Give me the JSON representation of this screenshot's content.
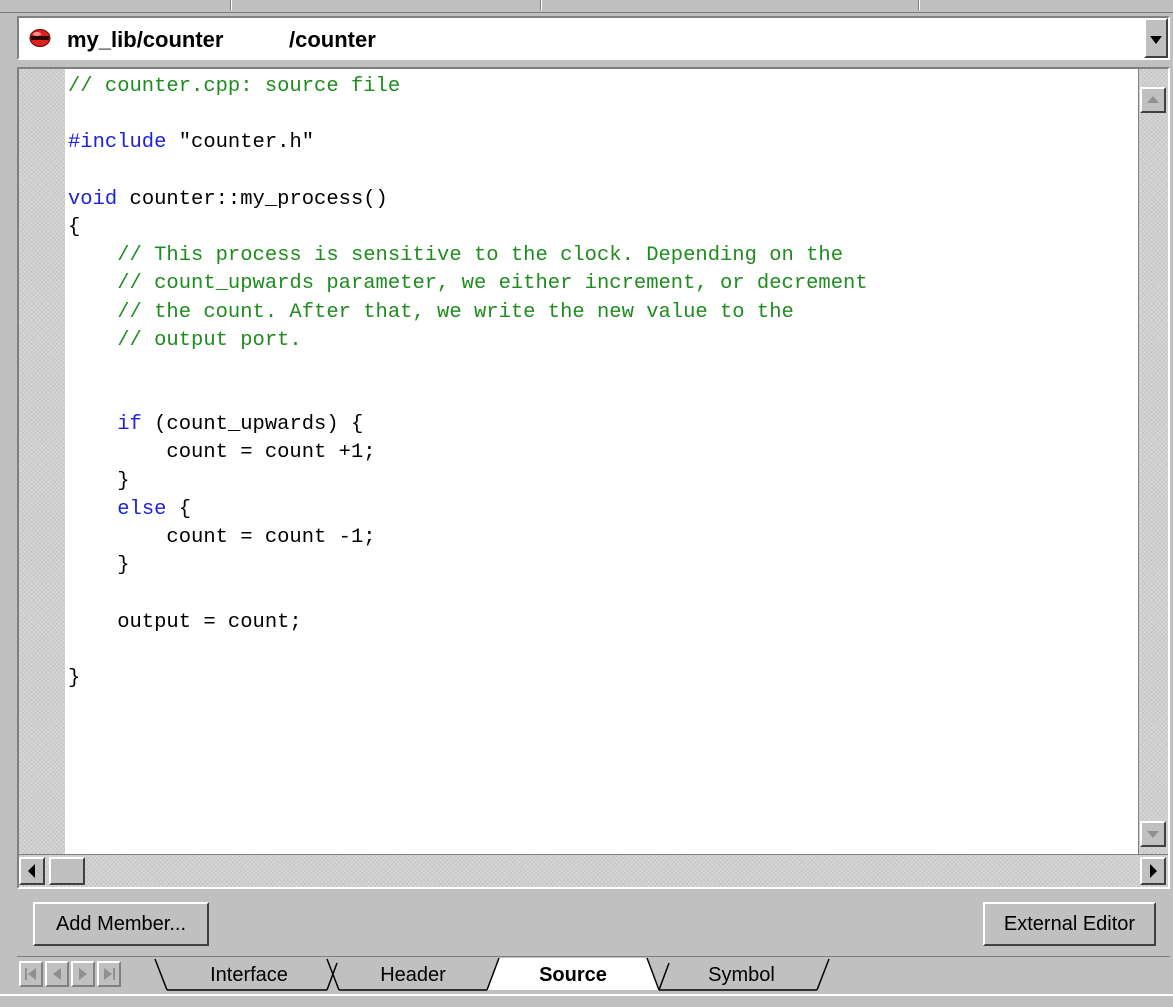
{
  "header": {
    "library": "my_lib/counter",
    "path": "/counter",
    "dropdown_icon": "dropdown-arrow-icon",
    "context_icon": "red-block-icon"
  },
  "code": {
    "lines": [
      [
        {
          "t": "// counter.cpp: source file",
          "c": "cm"
        }
      ],
      [],
      [
        {
          "t": "#include",
          "c": "kw"
        },
        {
          "t": " \"counter.h\"",
          "c": ""
        }
      ],
      [],
      [
        {
          "t": "void",
          "c": "kw"
        },
        {
          "t": " counter::my_process()",
          "c": ""
        }
      ],
      [
        {
          "t": "{",
          "c": ""
        }
      ],
      [
        {
          "t": "    // This process is sensitive to the clock. Depending on the",
          "c": "cm"
        }
      ],
      [
        {
          "t": "    // count_upwards parameter, we either increment, or decrement",
          "c": "cm"
        }
      ],
      [
        {
          "t": "    // the count. After that, we write the new value to the",
          "c": "cm"
        }
      ],
      [
        {
          "t": "    // output port.",
          "c": "cm"
        }
      ],
      [],
      [],
      [
        {
          "t": "    ",
          "c": ""
        },
        {
          "t": "if",
          "c": "kw"
        },
        {
          "t": " (count_upwards) {",
          "c": ""
        }
      ],
      [
        {
          "t": "        count = count +1;",
          "c": ""
        }
      ],
      [
        {
          "t": "    }",
          "c": ""
        }
      ],
      [
        {
          "t": "    ",
          "c": ""
        },
        {
          "t": "else",
          "c": "kw"
        },
        {
          "t": " {",
          "c": ""
        }
      ],
      [
        {
          "t": "        count = count -1;",
          "c": ""
        }
      ],
      [
        {
          "t": "    }",
          "c": ""
        }
      ],
      [],
      [
        {
          "t": "    output = count;",
          "c": ""
        }
      ],
      [],
      [
        {
          "t": "}",
          "c": ""
        }
      ]
    ]
  },
  "buttons": {
    "add_member": "Add Member...",
    "external_editor": "External Editor"
  },
  "tabs": [
    {
      "label": "Interface",
      "active": false
    },
    {
      "label": "Header",
      "active": false
    },
    {
      "label": "Source",
      "active": true
    },
    {
      "label": "Symbol",
      "active": false
    }
  ],
  "colors": {
    "comment": "#1e8c1e",
    "keyword": "#1f22d6",
    "icon_red": "#e02020"
  }
}
